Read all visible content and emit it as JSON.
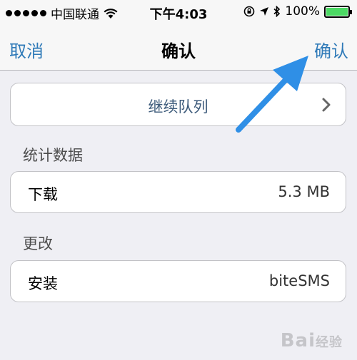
{
  "status_bar": {
    "carrier": "中国联通",
    "time": "下午4:03",
    "battery": "100%",
    "battery_fraction": 1.0
  },
  "nav": {
    "cancel_label": "取消",
    "title": "确认",
    "confirm_label": "确认"
  },
  "queue_button": {
    "label": "继续队列"
  },
  "statistics": {
    "header": "统计数据",
    "download_label": "下载",
    "download_value": "5.3 MB"
  },
  "changes": {
    "header": "更改",
    "install_label": "安装",
    "install_value": "biteSMS"
  },
  "annotation": {
    "color": "#2f8fe6",
    "icon": "arrow-up-right-icon"
  },
  "watermark": "Bai 经验"
}
